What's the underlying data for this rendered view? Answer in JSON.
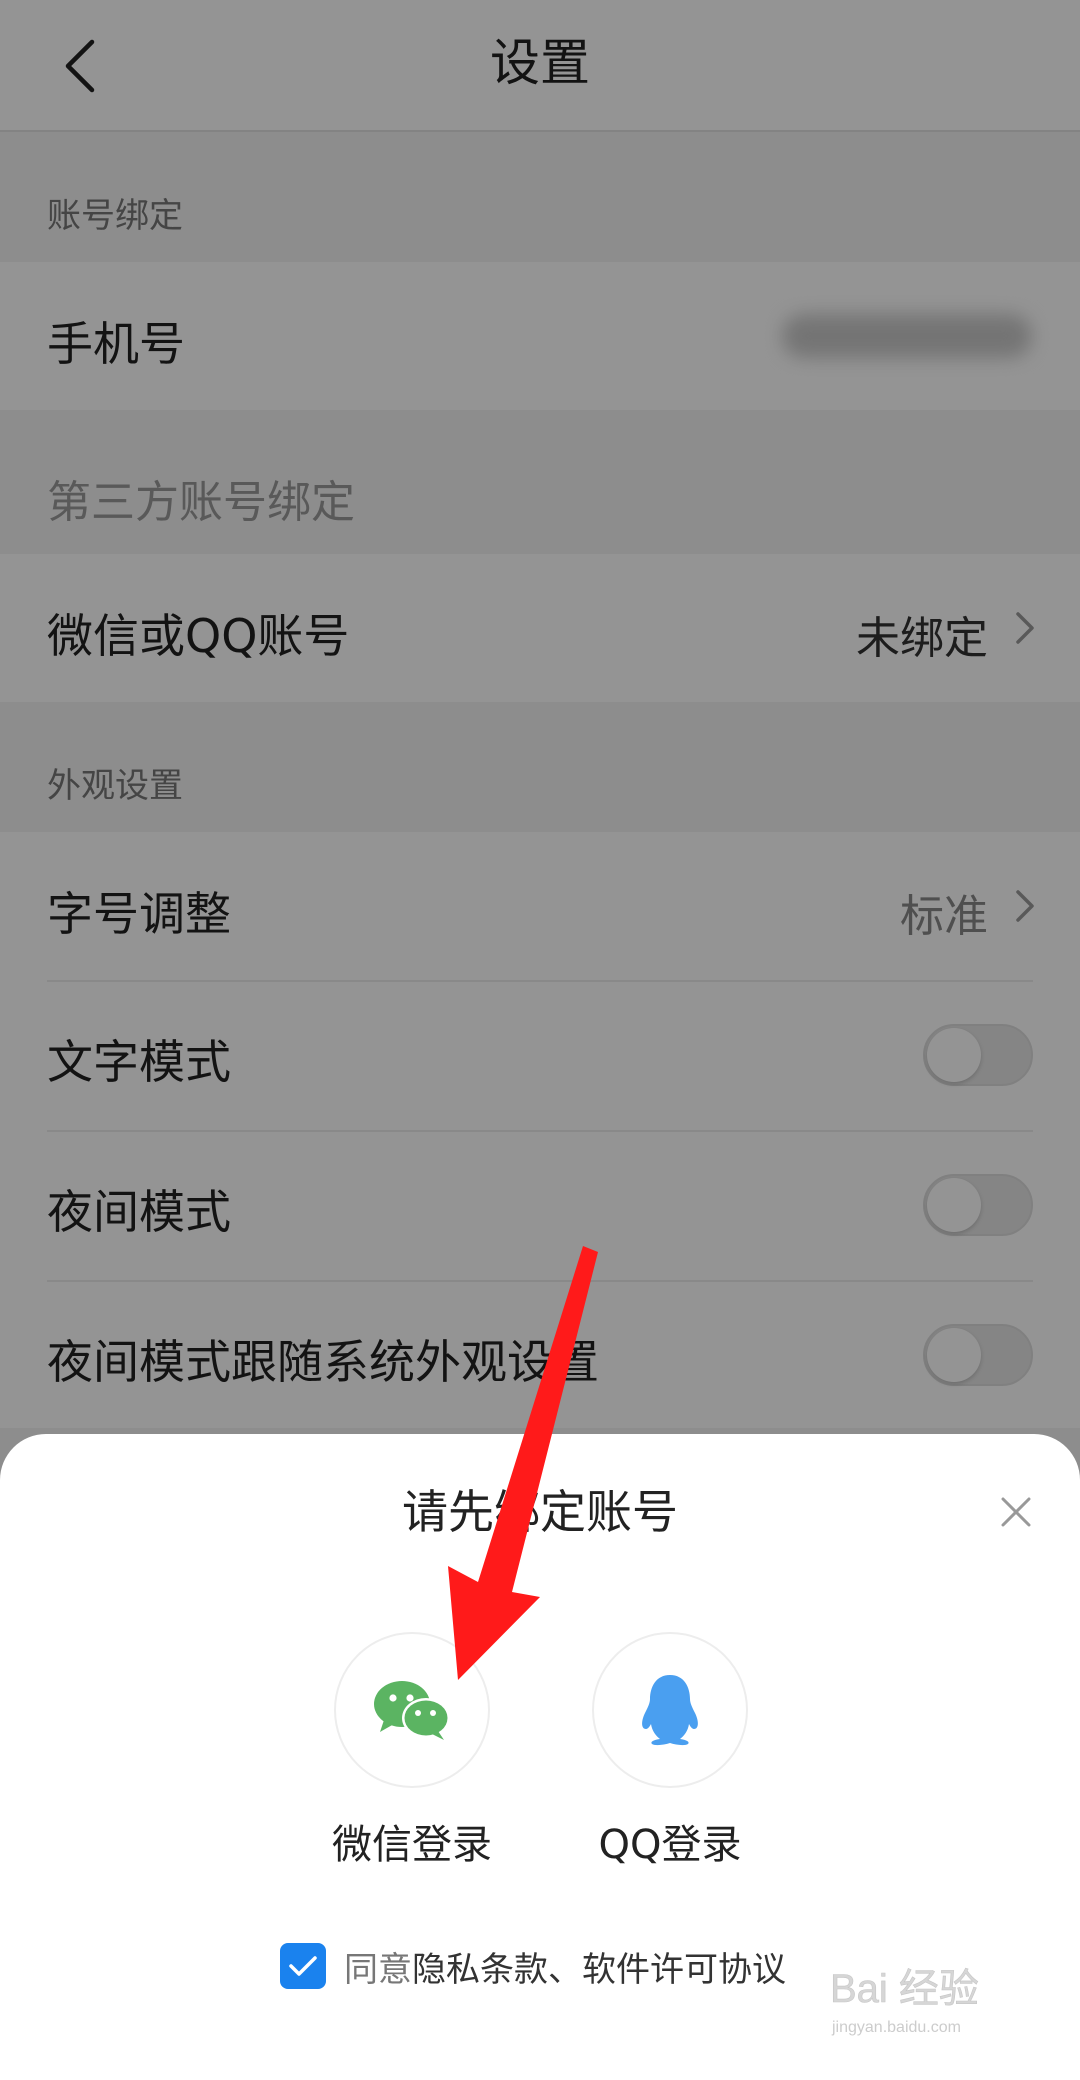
{
  "header": {
    "title": "设置"
  },
  "sections": {
    "account_binding": "账号绑定",
    "third_party": "第三方账号绑定",
    "appearance": "外观设置"
  },
  "rows": {
    "phone": {
      "label": "手机号"
    },
    "wechat_qq": {
      "label": "微信或QQ账号",
      "value": "未绑定"
    },
    "font_size": {
      "label": "字号调整",
      "value": "标准"
    },
    "text_mode": {
      "label": "文字模式",
      "toggle": "off"
    },
    "night_mode": {
      "label": "夜间模式",
      "toggle": "off"
    },
    "night_follow": {
      "label": "夜间模式跟随系统外观设置",
      "toggle": "off"
    }
  },
  "sheet": {
    "title": "请先绑定账号",
    "wechat_login": "微信登录",
    "qq_login": "QQ登录",
    "agree_prefix": "同意",
    "agree_links": "隐私条款、软件许可协议",
    "agree_checked": true
  },
  "colors": {
    "wechat_green": "#5bb462",
    "qq_blue": "#4a9ff0",
    "checkbox_blue": "#1a82ee",
    "annotation_red": "#ff1a1a"
  },
  "watermark": {
    "text": "Bai 经验",
    "sub": "jingyan.baidu.com"
  }
}
